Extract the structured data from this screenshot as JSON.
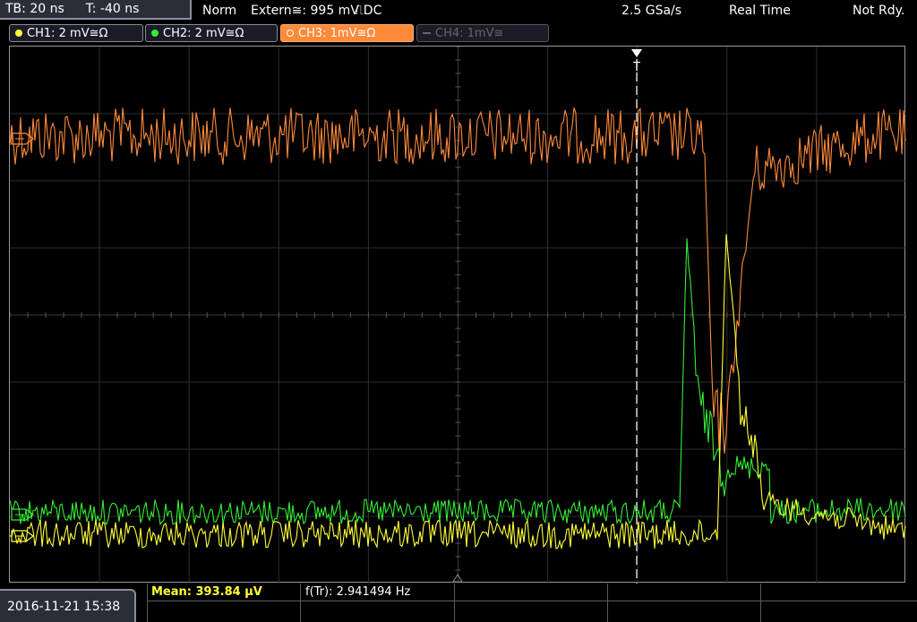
{
  "status": {
    "timebase": "TB: 20 ns",
    "trigger_time": "T: -40 ns",
    "mode": "Norm",
    "trigger_source": "Extern≅: 995 mV",
    "trigger_slope": "⎍DC",
    "sample_rate": "2.5 GSa/s",
    "acquisition": "Real Time",
    "ready_state": "Not Rdy."
  },
  "channels": [
    {
      "label": "CH1: 2 mV≅Ω",
      "color": "#ffff3a",
      "active": true
    },
    {
      "label": "CH2: 2 mV≅Ω",
      "color": "#33ee33",
      "active": true
    },
    {
      "label": "CH3: 1mV≅Ω",
      "color": "#ff8a3a",
      "active": true,
      "selected": true
    },
    {
      "label": "CH4: 1mV≅",
      "color": "#666666",
      "active": false
    }
  ],
  "trigger_marker": "T",
  "bottom": {
    "datetime": "2016-11-21 15:38",
    "measurements": [
      {
        "label": "Mean: 393.84 µV",
        "color": "#ffff3a"
      },
      {
        "label": "f(Tr): 2.941494 Hz",
        "color": "#ffffff"
      }
    ]
  },
  "colors": {
    "ch1": "#ffff3a",
    "ch2": "#33ee33",
    "ch3": "#ff8a3a",
    "grid": "#3a3a3a",
    "panel": "#2b2e38"
  }
}
